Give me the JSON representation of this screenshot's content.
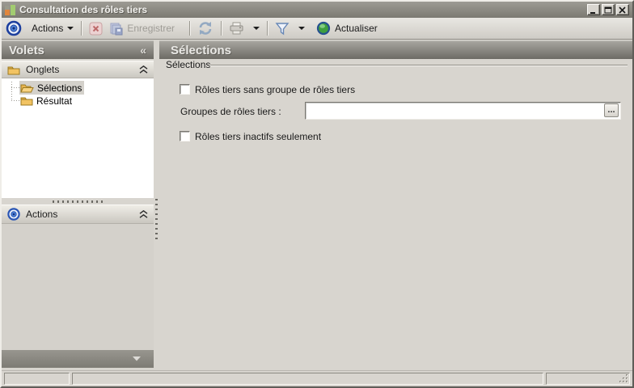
{
  "window": {
    "title": "Consultation des rôles tiers"
  },
  "toolbar": {
    "actions": "Actions",
    "enregistrer": "Enregistrer",
    "actualiser": "Actualiser"
  },
  "volets": {
    "header": "Volets",
    "collapse_glyph": "«",
    "onglets_label": "Onglets",
    "actions_label": "Actions",
    "tree": [
      {
        "label": "Sélections",
        "selected": true
      },
      {
        "label": "Résultat",
        "selected": false
      }
    ]
  },
  "selections": {
    "header": "Sélections",
    "group_label": "Sélections",
    "checkbox_no_group": "Rôles tiers sans groupe de rôles tiers",
    "group_field_label": "Groupes de rôles tiers :",
    "group_field_value": "",
    "browse": "...",
    "checkbox_inactive": "Rôles tiers inactifs seulement"
  },
  "statusbar": {
    "panel1": "",
    "panel2": "",
    "panel3": ""
  },
  "icons": {
    "app": "bar-chart",
    "target": "◎",
    "delete": "✕",
    "save": "💾",
    "refresh": "⇄",
    "printer": "🖨",
    "filter": "funnel",
    "actualiser": "↻",
    "dropdown": "▼",
    "collapse_section": "⌃⌃",
    "minimize": "_",
    "maximize": "□",
    "close": "✕"
  },
  "colors": {
    "window_bg": "#d8d5cf",
    "titlebar_gray": "#8b8981",
    "header_text": "#e9e8e5",
    "accent_blue": "#1d3f9e",
    "accent_green": "#3f9f3f",
    "folder_yellow": "#f2c362",
    "disabled_text": "#9e9c96"
  }
}
